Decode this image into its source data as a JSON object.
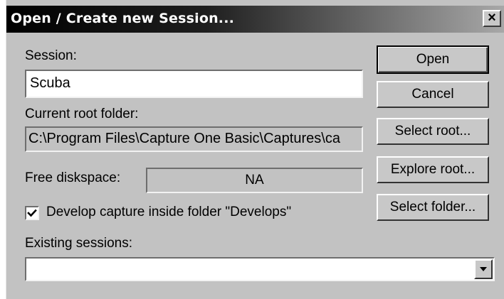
{
  "window": {
    "title": "Open / Create new Session...",
    "close_glyph": "×"
  },
  "session": {
    "label": "Session:",
    "value": "Scuba"
  },
  "root_folder": {
    "label": "Current root folder:",
    "value": "C:\\Program Files\\Capture One Basic\\Captures\\ca"
  },
  "diskspace": {
    "label": "Free diskspace:",
    "value": "NA"
  },
  "develop_option": {
    "label": "Develop capture inside folder \"Develops\"",
    "checked": true
  },
  "existing_sessions": {
    "label": "Existing sessions:",
    "selected": ""
  },
  "buttons": {
    "open": "Open",
    "cancel": "Cancel",
    "select_root": "Select root...",
    "explore_root": "Explore root...",
    "select_folder": "Select folder..."
  },
  "icons": {
    "close": "close-icon",
    "check": "checkmark-icon",
    "dropdown": "dropdown-arrow-icon"
  }
}
